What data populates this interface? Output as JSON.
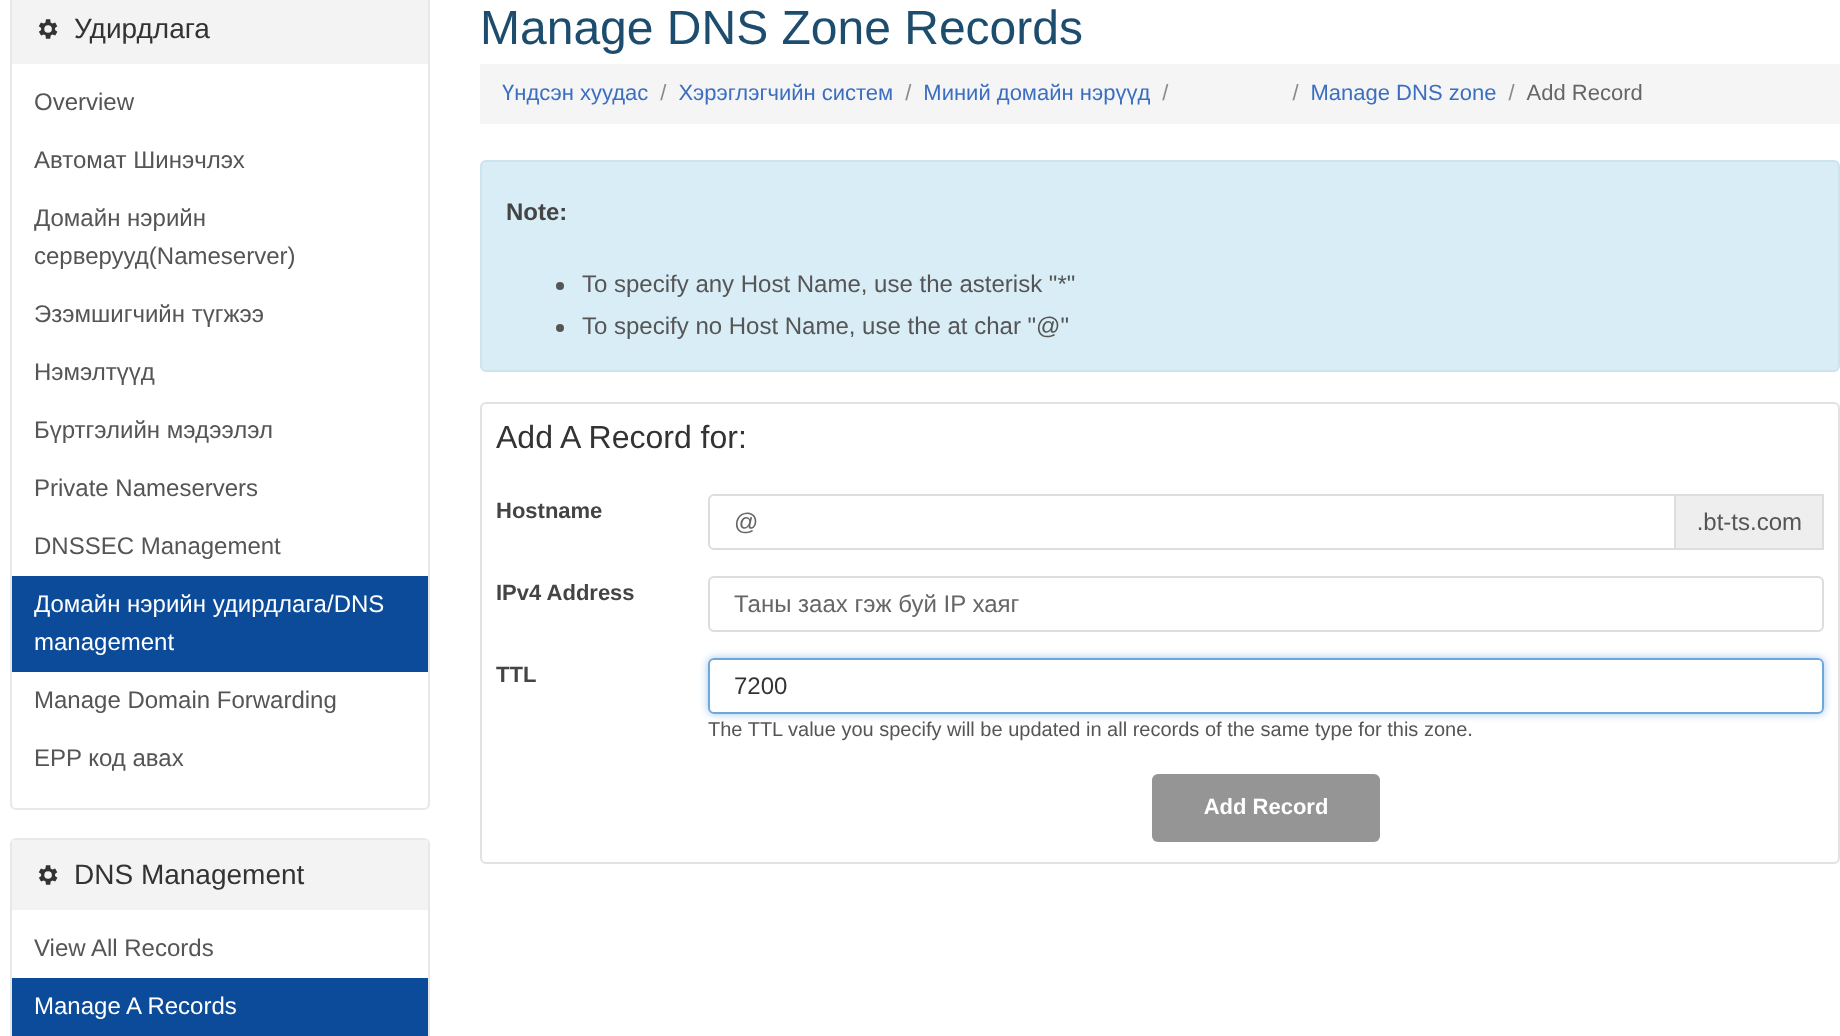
{
  "sidebar": {
    "panels": [
      {
        "title": "Удирдлага",
        "items": [
          {
            "label": "Overview",
            "selected": false
          },
          {
            "label": "Автомат Шинэчлэх",
            "selected": false
          },
          {
            "label": "Домайн нэрийн серверууд(Nameserver)",
            "selected": false
          },
          {
            "label": "Эзэмшигчийн түгжээ",
            "selected": false
          },
          {
            "label": "Нэмэлтүүд",
            "selected": false
          },
          {
            "label": "Бүртгэлийн мэдээлэл",
            "selected": false
          },
          {
            "label": "Private Nameservers",
            "selected": false
          },
          {
            "label": "DNSSEC Management",
            "selected": false
          },
          {
            "label": "Домайн нэрийн удирдлага/DNS management",
            "selected": true
          },
          {
            "label": "Manage Domain Forwarding",
            "selected": false
          },
          {
            "label": "EPP код авах",
            "selected": false
          }
        ]
      },
      {
        "title": "DNS Management",
        "items": [
          {
            "label": "View All Records",
            "selected": false
          },
          {
            "label": "Manage A Records",
            "selected": true
          }
        ]
      }
    ]
  },
  "page_title": "Manage DNS Zone Records",
  "breadcrumb_separator": "/",
  "breadcrumb": [
    {
      "kind": "link",
      "label": "Үндсэн хуудас"
    },
    {
      "kind": "link",
      "label": "Хэрэглэгчийн систем"
    },
    {
      "kind": "link",
      "label": "Миний домайн нэрүүд"
    },
    {
      "kind": "hidden"
    },
    {
      "kind": "link",
      "label": "Manage DNS zone"
    },
    {
      "kind": "current",
      "label": "Add Record"
    }
  ],
  "note": {
    "title": "Note:",
    "items": [
      "To specify any Host Name, use the asterisk \"*\"",
      "To specify no Host Name, use the at char \"@\""
    ]
  },
  "form": {
    "title": "Add A Record for:",
    "fields": [
      {
        "label": "Hostname",
        "placeholder": "@",
        "addon": ".bt-ts.com",
        "focused": false
      },
      {
        "label": "IPv4 Address",
        "placeholder": "Таны заах гэж буй IP хаяг",
        "focused": false
      },
      {
        "label": "TTL",
        "value": "7200",
        "focused": true,
        "help": "The TTL value you specify will be updated in all records of the same type for this zone."
      }
    ],
    "submit": {
      "label": "Add Record",
      "disabled": true
    }
  }
}
